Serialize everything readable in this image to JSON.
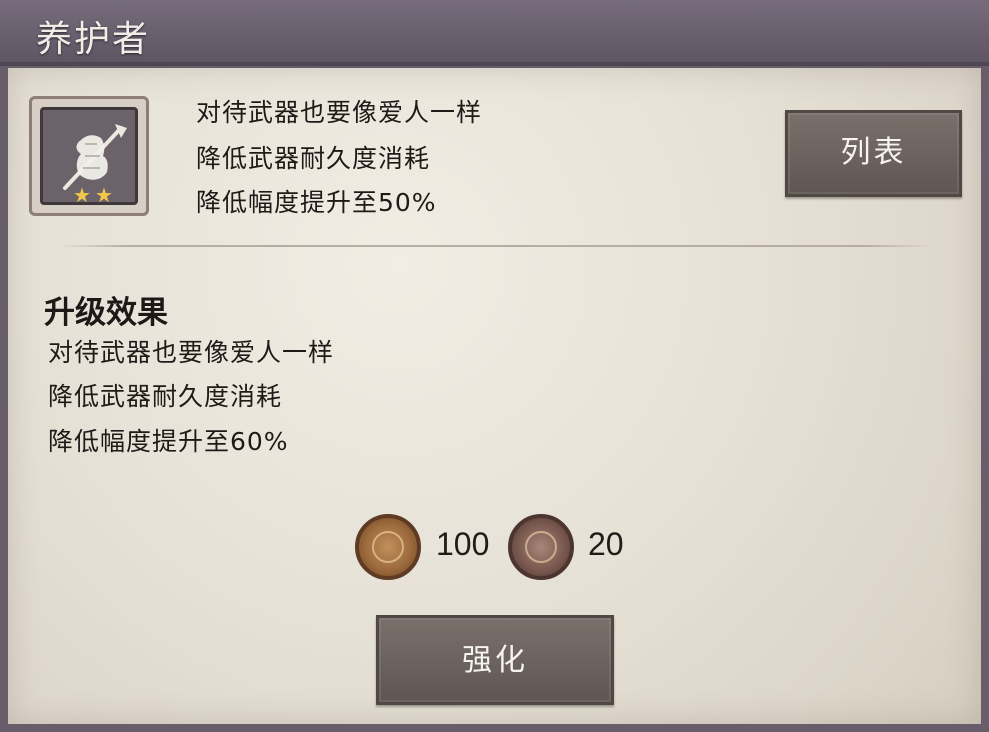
{
  "header": {
    "title": "养护者"
  },
  "skill": {
    "icon": "weapon-care-icon",
    "stars": 2,
    "description": [
      "对待武器也要像爱人一样",
      "降低武器耐久度消耗",
      "降低幅度提升至50%"
    ]
  },
  "buttons": {
    "list": "列表",
    "strengthen": "强化"
  },
  "upgrade": {
    "title": "升级效果",
    "lines": [
      "对待武器也要像爱人一样",
      "降低武器耐久度消耗",
      "降低幅度提升至60%"
    ]
  },
  "costs": [
    {
      "icon": "bronze-coin-icon",
      "amount": "100"
    },
    {
      "icon": "copper-coin-icon",
      "amount": "20"
    }
  ],
  "colors": {
    "header": "#675d6b",
    "panel": "#e7e2d7",
    "button": "#6d6461",
    "star": "#f1c84b"
  }
}
